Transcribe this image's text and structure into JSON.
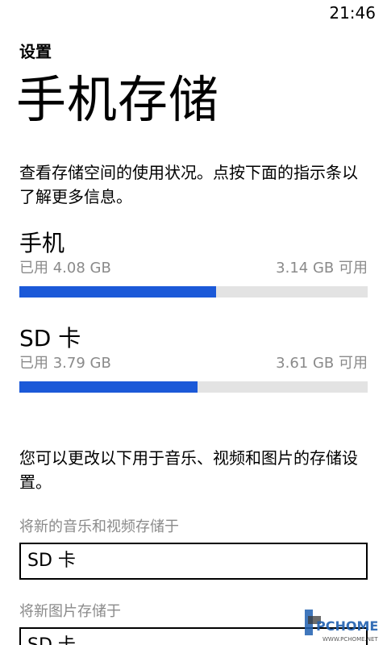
{
  "status_bar": {
    "time": "21:46"
  },
  "header": {
    "section": "设置",
    "title": "手机存储"
  },
  "description": "查看存储空间的使用状况。点按下面的指示条以了解更多信息。",
  "storage": [
    {
      "name": "手机",
      "used": "已用 4.08 GB",
      "free": "3.14 GB 可用",
      "used_fraction": 0.565
    },
    {
      "name": "SD 卡",
      "used": "已用 3.79 GB",
      "free": "3.61 GB 可用",
      "used_fraction": 0.512
    }
  ],
  "settings_description": "您可以更改以下用于音乐、视频和图片的存储设置。",
  "music_video_setting": {
    "label": "将新的音乐和视频存储于",
    "value": "SD 卡"
  },
  "pictures_setting": {
    "label": "将新图片存储于",
    "value": "SD 卡"
  },
  "watermark": {
    "logo_text": "PCHOME",
    "url_text": "WWW.PCHOME.NET",
    "colors": {
      "primary": "#1f5fb0",
      "secondary": "#3a3a3a"
    }
  },
  "colors": {
    "accent": "#1b59d8",
    "track": "#e3e3e3",
    "secondary_text": "#8a8a8a"
  }
}
